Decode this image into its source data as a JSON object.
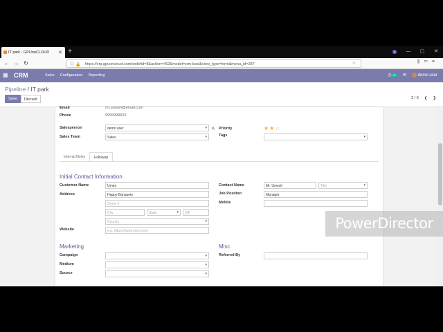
{
  "browser": {
    "tab_title": "IT park - GPUonCLOUD",
    "url": "https://erp.gpuoncloud.com/web#id=8&action=452&model=crm.lead&view_type=form&menu_id=287"
  },
  "app": {
    "brand": "CRM",
    "menu": [
      "Sales",
      "Configuration",
      "Reporting"
    ],
    "chat_badge": "12",
    "user": "demo user"
  },
  "control": {
    "breadcrumb_parent": "Pipeline",
    "breadcrumb_sep": "/",
    "breadcrumb_current": "IT park",
    "save_label": "Save",
    "discard_label": "Discard",
    "pager": "2 / 6"
  },
  "form": {
    "email_label": "Email",
    "email_value": "mr.umesh@email.com",
    "phone_label": "Phone",
    "phone_value": "9999999922",
    "salesperson_label": "Salesperson",
    "salesperson_value": "demo user",
    "sales_team_label": "Sales Team",
    "sales_team_value": "Sales",
    "priority_label": "Priority",
    "priority_stars": 2,
    "priority_max": 3,
    "tags_label": "Tags",
    "tab_internal_notes": "Internal Notes",
    "tab_followup": "Followup",
    "section_contact": "Initial Contact Information",
    "customer_name_label": "Customer Name",
    "customer_name_value": "Umes",
    "address_label": "Address",
    "street_value": "Happy Banquets",
    "street2_placeholder": "Street 2",
    "city_placeholder": "City",
    "state_placeholder": "State",
    "zip_placeholder": "ZIP",
    "country_placeholder": "Country",
    "website_label": "Website",
    "website_placeholder": "e.g. https://www.odoo.com",
    "contact_name_label": "Contact Name",
    "contact_name_value": "Mr. Umesh",
    "title_placeholder": "Title",
    "job_position_label": "Job Position",
    "job_position_value": "Manager",
    "mobile_label": "Mobile",
    "section_marketing": "Marketing",
    "campaign_label": "Campaign",
    "medium_label": "Medium",
    "source_label": "Source",
    "section_misc": "Misc",
    "referred_by_label": "Referred By"
  },
  "watermark": "PowerDirector"
}
